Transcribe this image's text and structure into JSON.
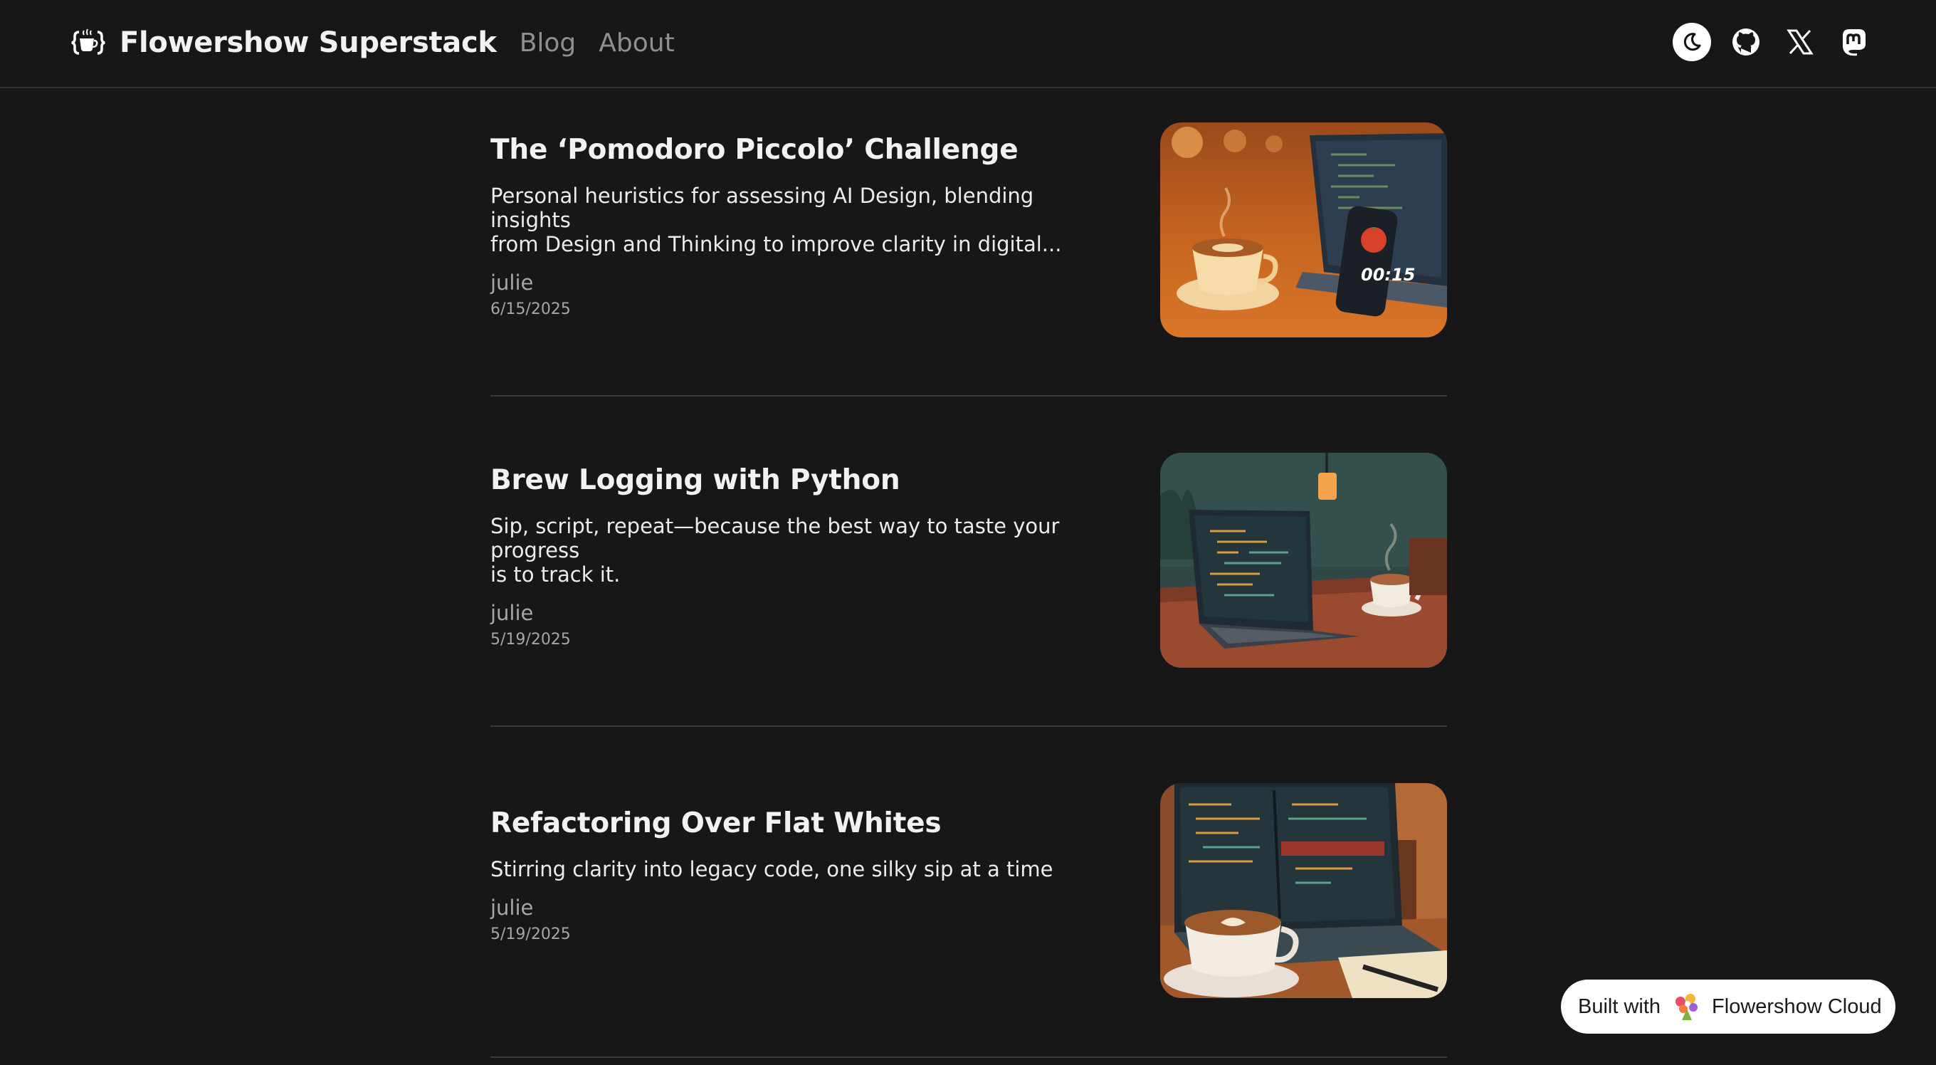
{
  "header": {
    "brand_title": "Flowershow Superstack",
    "brand_icon": "coffee-cup-braces-icon",
    "nav": [
      "Blog",
      "About"
    ],
    "icons": [
      "moon-icon",
      "github-icon",
      "x-icon",
      "mastodon-icon"
    ]
  },
  "posts": [
    {
      "title": "The ‘Pomodoro Piccolo’ Challenge",
      "description_line1": "Personal heuristics for assessing AI Design, blending insights",
      "description_line2": "from Design and Thinking to improve clarity in digital...",
      "author": "julie",
      "date": "6/15/2025",
      "image_timer_text": "00:15"
    },
    {
      "title": "Brew Logging with Python",
      "description_line1": "Sip, script, repeat—because the best way to taste your progress",
      "description_line2": "is to track it.",
      "author": "julie",
      "date": "5/19/2025"
    },
    {
      "title": "Refactoring Over Flat Whites",
      "description_line1": "Stirring clarity into legacy code, one silky sip at a time",
      "description_line2": "",
      "author": "julie",
      "date": "5/19/2025"
    }
  ],
  "badge": {
    "prefix": "Built with",
    "name": "Flowershow Cloud",
    "icon": "bouquet-icon"
  },
  "colors": {
    "background": "#171717",
    "text": "#ececec",
    "muted": "#a6a6a6",
    "nav": "#8f8f8f"
  }
}
